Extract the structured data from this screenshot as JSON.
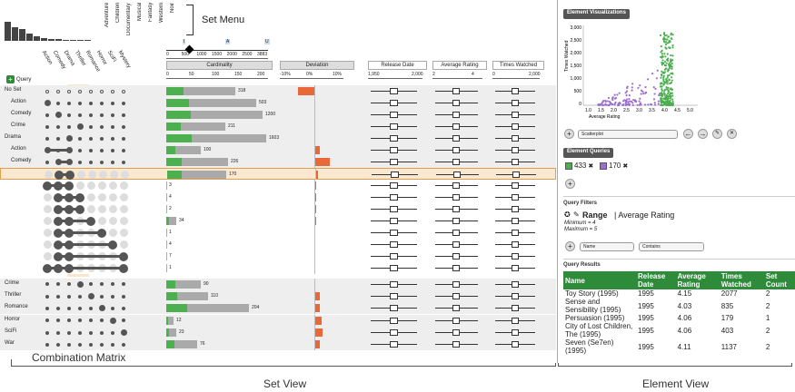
{
  "set_menu": {
    "label": "Set Menu",
    "items": [
      "Adventure",
      "Children",
      "Documentary",
      "Musical",
      "Fantasy",
      "Western",
      "Noir"
    ],
    "bar_values": [
      0.55,
      0.4,
      0.35,
      0.2,
      0.12,
      0.08,
      0.05,
      0.04,
      0.03,
      0.02,
      0.02,
      0.02
    ]
  },
  "sets": {
    "columns": [
      "Action",
      "Comedy",
      "Drama",
      "Thriller",
      "Romance",
      "Horror",
      "SciFi",
      "Mystery"
    ],
    "add_query_label": "Query"
  },
  "header": {
    "cardinality": "Cardinality",
    "deviation": "Deviation",
    "release_date": "Release Date",
    "average_rating": "Average Rating",
    "times_watched": "Times Watched",
    "card_slider_ticks": [
      "0",
      "500",
      "1000",
      "1500",
      "2000",
      "2500",
      "3883"
    ],
    "card_ticks": [
      "0",
      "50",
      "100",
      "150",
      "200"
    ],
    "dev_ticks": [
      "-10%",
      "0%",
      "10%"
    ],
    "date_ticks": [
      "1,950",
      "2,000"
    ],
    "rating_ticks": [
      "2",
      "4"
    ],
    "watched_ticks": [
      "0",
      "2,000"
    ],
    "slider_markers": [
      "I",
      "A",
      "U"
    ]
  },
  "rows": [
    {
      "label": "No Set",
      "type": "group",
      "count": "318",
      "card": 0.2,
      "dev": -0.6
    },
    {
      "label": "Action",
      "type": "sub",
      "count": "503",
      "card": 0.26,
      "dev": 0
    },
    {
      "label": "Comedy",
      "type": "sub",
      "count": "1200",
      "card": 0.28,
      "dev": 0
    },
    {
      "label": "Crime",
      "type": "sub",
      "count": "211",
      "card": 0.17,
      "dev": 0
    },
    {
      "label": "Drama",
      "type": "group",
      "count": "1603",
      "card": 0.29,
      "dev": 0
    },
    {
      "label": "Action",
      "type": "sub",
      "count": "100",
      "card": 0.1,
      "dev": 0.2
    },
    {
      "label": "Comedy",
      "type": "sub",
      "count": "226",
      "card": 0.18,
      "dev": 0.55
    },
    {
      "label": "",
      "type": "sel",
      "count": "170",
      "card": 0.17,
      "dev": 0.1
    },
    {
      "label": "",
      "type": "comb",
      "count": "3",
      "card": 0,
      "dev": 0.05
    },
    {
      "label": "",
      "type": "comb",
      "count": "4",
      "card": 0,
      "dev": 0.05
    },
    {
      "label": "",
      "type": "comb",
      "count": "2",
      "card": 0,
      "dev": 0.05
    },
    {
      "label": "",
      "type": "comb",
      "count": "34",
      "card": 0.03,
      "dev": 0.05
    },
    {
      "label": "",
      "type": "comb",
      "count": "1",
      "card": 0,
      "dev": 0
    },
    {
      "label": "",
      "type": "comb",
      "count": "4",
      "card": 0,
      "dev": 0
    },
    {
      "label": "",
      "type": "comb",
      "count": "7",
      "card": 0,
      "dev": 0
    },
    {
      "label": "",
      "type": "comb",
      "count": "1",
      "card": 0,
      "dev": 0
    },
    {
      "label": "Crime",
      "type": "group",
      "count": "90",
      "card": 0.1,
      "dev": 0
    },
    {
      "label": "Thriller",
      "type": "group",
      "count": "110",
      "card": 0.12,
      "dev": 0.2
    },
    {
      "label": "Romance",
      "type": "group",
      "count": "204",
      "card": 0.24,
      "dev": 0.2
    },
    {
      "label": "Horror",
      "type": "group",
      "count": "12",
      "card": 0.02,
      "dev": 0.25
    },
    {
      "label": "SciFi",
      "type": "group",
      "count": "23",
      "card": 0.03,
      "dev": 0.3
    },
    {
      "label": "War",
      "type": "group",
      "count": "76",
      "card": 0.09,
      "dev": 0.2
    }
  ],
  "element_view": {
    "viz_title": "Element Visualizations",
    "plot_ylabel": "Times Watched",
    "plot_xlabel": "Average Rating",
    "plot_yticks": [
      "3,000",
      "2,500",
      "2,000",
      "1,500",
      "1,000",
      "500",
      "0"
    ],
    "plot_xticks": [
      "1.0",
      "1.5",
      "2.0",
      "2.5",
      "3.0",
      "3.5",
      "4.0",
      "4.5",
      "5.0"
    ],
    "plot_type_select": "Scatterplot",
    "queries_title": "Element Queries",
    "query_chips": [
      {
        "count": "433",
        "color": "#4caf50"
      },
      {
        "count": "170",
        "color": "#9c6fcf"
      }
    ],
    "filters_title": "Query Filters",
    "filter_label": "Range",
    "filter_attr": "| Average Rating",
    "filter_min": "Minimum = 4",
    "filter_max": "Maximum = 5",
    "name_select": "Name",
    "op_select": "Contains",
    "results_title": "Query Results",
    "columns": [
      "Name",
      "Release Date",
      "Average Rating",
      "Times Watched",
      "Set Count"
    ],
    "results": [
      [
        "Toy Story (1995)",
        "1995",
        "4.15",
        "2077",
        "2"
      ],
      [
        "Sense and Sensibility (1995)",
        "1995",
        "4.03",
        "835",
        "2"
      ],
      [
        "Persuasion (1995)",
        "1995",
        "4.06",
        "179",
        "1"
      ],
      [
        "City of Lost Children, The (1995)",
        "1995",
        "4.06",
        "403",
        "2"
      ],
      [
        "Seven (Se7en) (1995)",
        "1995",
        "4.11",
        "1137",
        "2"
      ]
    ]
  },
  "captions": {
    "combination_matrix": "Combination Matrix",
    "set_view": "Set View",
    "element_view": "Element View"
  },
  "colors": {
    "green": "#4caf50",
    "gray": "#aaa",
    "orange": "#e8683a",
    "highlight": "#f7dcb8",
    "selected": "#fbe8d0",
    "purple": "#9c6fcf"
  }
}
